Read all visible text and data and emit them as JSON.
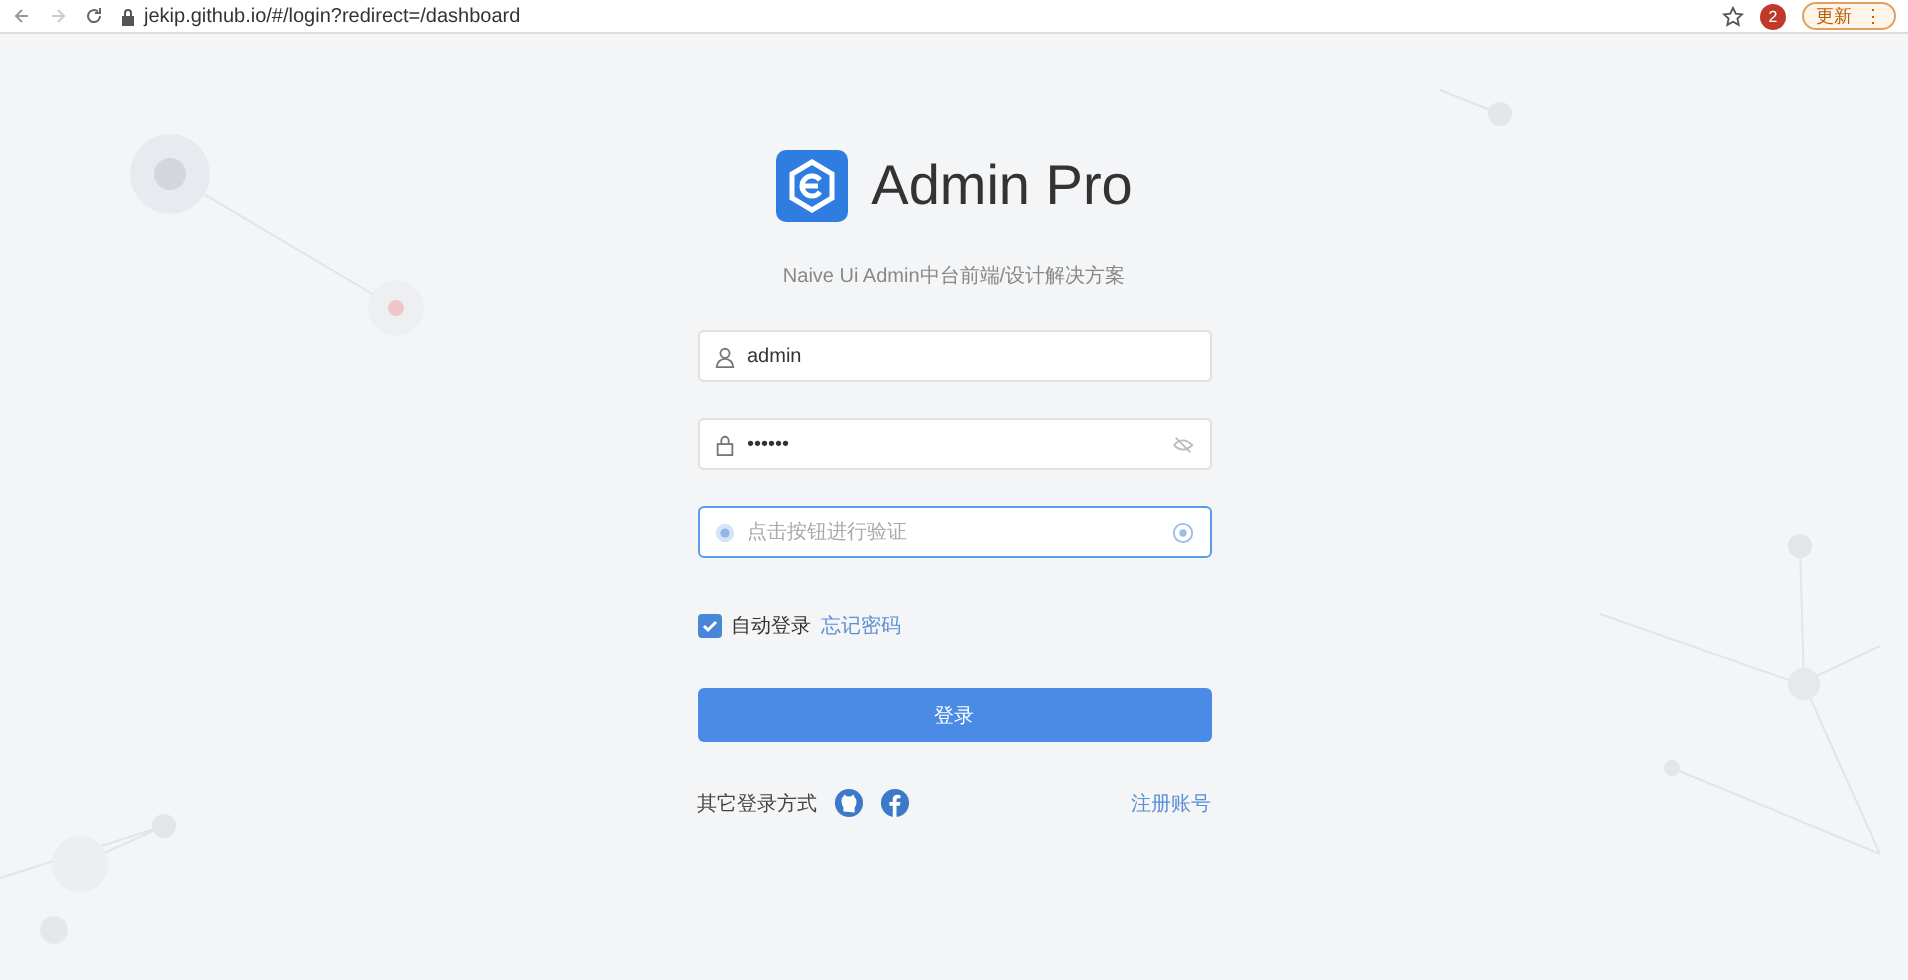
{
  "browser": {
    "url": "jekip.github.io/#/login?redirect=/dashboard",
    "profile_badge": "2",
    "update_button": "更新",
    "menu_glyph": "⋮"
  },
  "brand": {
    "title": "Admin Pro",
    "subtitle": "Naive Ui Admin中台前端/设计解决方案"
  },
  "form": {
    "username": {
      "value": "admin"
    },
    "password": {
      "value": "••••••"
    },
    "captcha": {
      "placeholder": "点击按钮进行验证"
    },
    "auto_login": {
      "label": "自动登录",
      "checked": true
    },
    "forgot_link": "忘记密码",
    "submit": "登录",
    "other_login": "其它登录方式",
    "register_link": "注册账号"
  }
}
